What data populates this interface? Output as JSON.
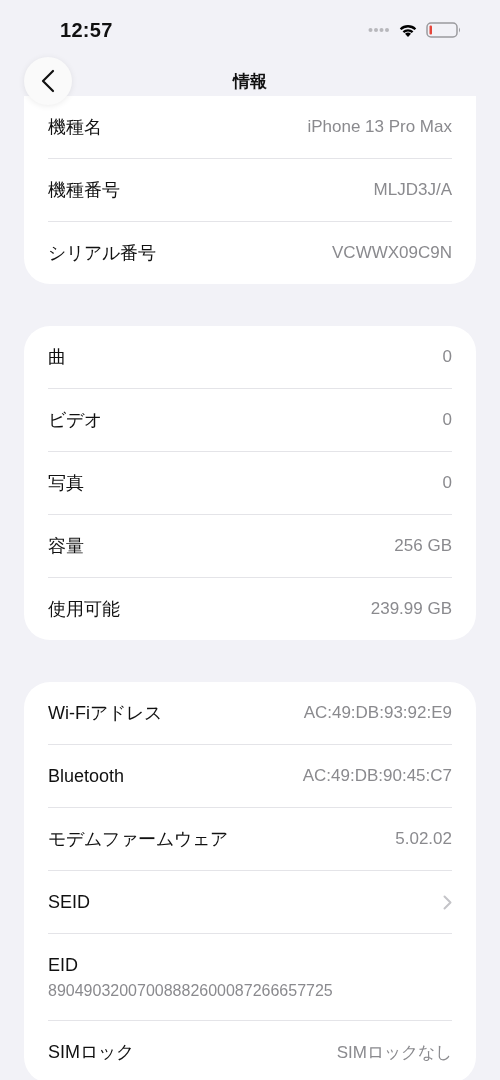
{
  "status_bar": {
    "time": "12:57"
  },
  "nav": {
    "title": "情報"
  },
  "sections": [
    {
      "rows": [
        {
          "kind": "value",
          "label": "機種名",
          "value": "iPhone 13 Pro Max"
        },
        {
          "kind": "value",
          "label": "機種番号",
          "value": "MLJD3J/A"
        },
        {
          "kind": "value",
          "label": "シリアル番号",
          "value": "VCWWX09C9N"
        }
      ]
    },
    {
      "rows": [
        {
          "kind": "value",
          "label": "曲",
          "value": "0"
        },
        {
          "kind": "value",
          "label": "ビデオ",
          "value": "0"
        },
        {
          "kind": "value",
          "label": "写真",
          "value": "0"
        },
        {
          "kind": "value",
          "label": "容量",
          "value": "256 GB"
        },
        {
          "kind": "value",
          "label": "使用可能",
          "value": "239.99 GB"
        }
      ]
    },
    {
      "rows": [
        {
          "kind": "value",
          "label": "Wi-Fiアドレス",
          "value": "AC:49:DB:93:92:E9"
        },
        {
          "kind": "value",
          "label": "Bluetooth",
          "value": "AC:49:DB:90:45:C7"
        },
        {
          "kind": "value",
          "label": "モデムファームウェア",
          "value": "5.02.02"
        },
        {
          "kind": "link",
          "label": "SEID"
        },
        {
          "kind": "stacked",
          "label": "EID",
          "value": "89049032007008882600087266657725"
        },
        {
          "kind": "value",
          "label": "SIMロック",
          "value": "SIMロックなし"
        }
      ]
    }
  ]
}
